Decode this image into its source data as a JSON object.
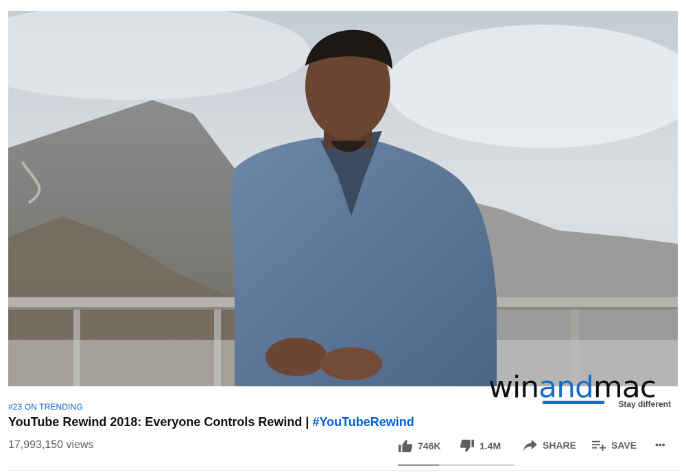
{
  "video": {
    "trending_badge": "#23 ON TRENDING",
    "title_main": "YouTube Rewind 2018: Everyone Controls Rewind | ",
    "title_hashtag": "#YouTubeRewind",
    "views": "17,993,150 views"
  },
  "watermark": {
    "part1": "win",
    "part2": "and",
    "part3": "mac",
    "tagline": "Stay different"
  },
  "actions": {
    "like_count": "746K",
    "dislike_count": "1.4M",
    "share_label": "SHARE",
    "save_label": "SAVE",
    "more_label": "•••"
  },
  "sentiment": {
    "like_fraction": 0.35
  },
  "icons": {
    "like": "thumbs-up-icon",
    "dislike": "thumbs-down-icon",
    "share": "share-arrow-icon",
    "save": "playlist-add-icon",
    "more": "more-horizontal-icon"
  },
  "colors": {
    "link_blue": "#065fd4",
    "watermark_blue": "#1a6fc4"
  }
}
